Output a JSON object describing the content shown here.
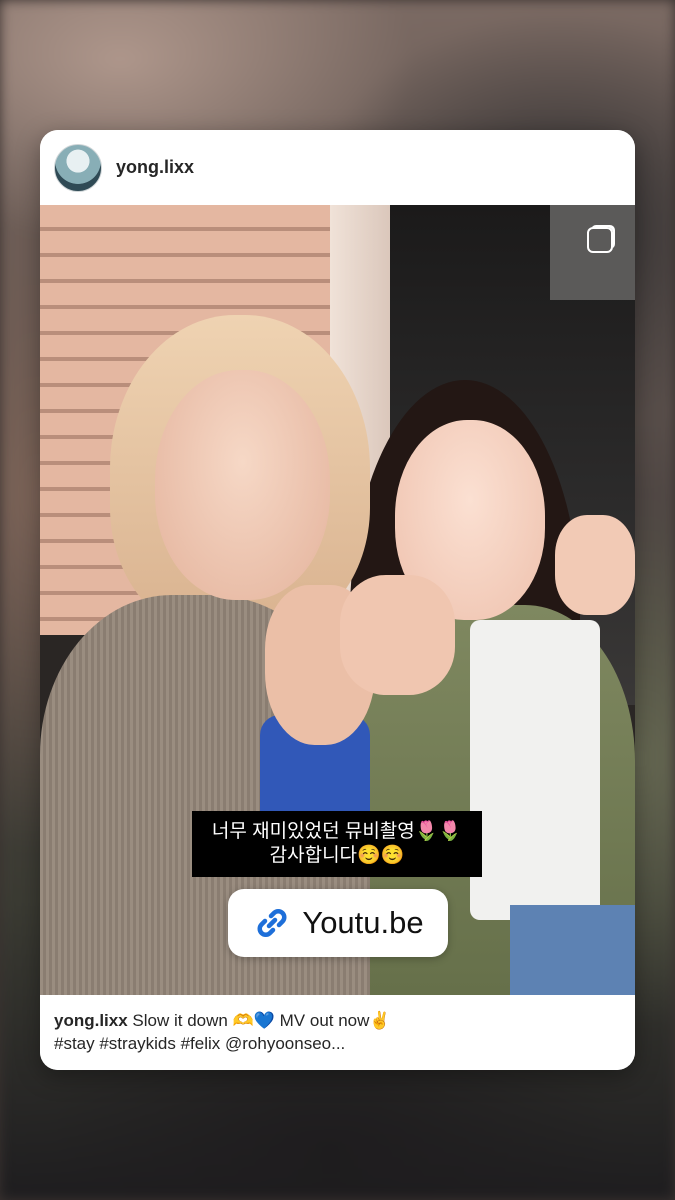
{
  "post": {
    "username": "yong.lixx",
    "sticker_line1": "너무 재미있었던 뮤비촬영🌷🌷",
    "sticker_line2": "감사합니다☺️☺️",
    "link_label": "Youtu.be",
    "caption_username": "yong.lixx",
    "caption_line1": "Slow it down 🫶💙 MV out now✌️",
    "caption_line2": "#stay #straykids #felix @rohyoonseo..."
  },
  "icons": {
    "multi_photo": "multiple-photos-icon",
    "link": "link-icon"
  },
  "colors": {
    "link_blue": "#1e6fd9",
    "text_dark": "#262626"
  }
}
